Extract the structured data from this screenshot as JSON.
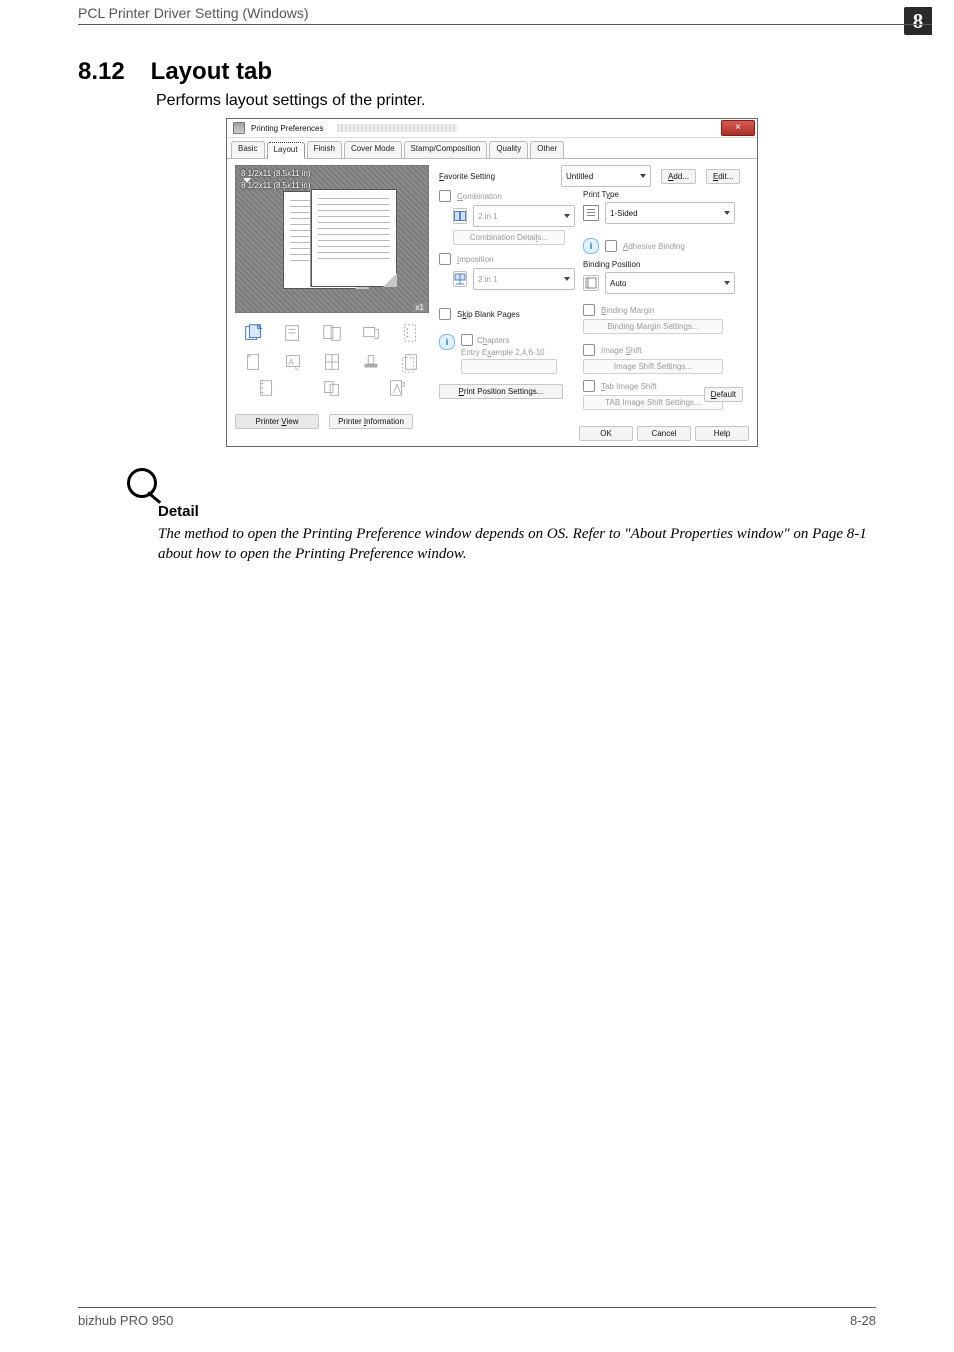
{
  "page": {
    "running_head": "PCL Printer Driver Setting (Windows)",
    "chapter_number": "8",
    "section_number": "8.12",
    "section_title": "Layout tab",
    "lead": "Performs layout settings of the printer.",
    "footer_left": "bizhub PRO 950",
    "footer_right": "8-28"
  },
  "dialog": {
    "title": "Printing Preferences",
    "tabs": {
      "basic": "Basic",
      "layout": "Layout",
      "finish": "Finish",
      "cover": "Cover Mode",
      "stamp": "Stamp/Composition",
      "quality": "Quality",
      "other": "Other"
    },
    "favorite": {
      "label": "Favorite Setting",
      "value": "Untitled",
      "add": "Add...",
      "edit": "Edit..."
    },
    "preview": {
      "dim_top": "8 1/2x11 (8.5x11 in)",
      "dim_bottom": "8 1/2x11 (8.5x11 in)",
      "multiplier": "x1"
    },
    "left_buttons": {
      "printer_view": "Printer View",
      "printer_info": "Printer Information"
    },
    "mid": {
      "combination_label": "Combination",
      "combination_value": "2 in 1",
      "combination_details": "Combination Details...",
      "imposition_label": "Imposition",
      "imposition_value": "2 in 1",
      "skip_blank": "Skip Blank Pages",
      "chapters_label": "Chapters",
      "chapters_hint": "Entry Example 2,4,6-10",
      "print_pos": "Print Position Settings..."
    },
    "right": {
      "print_type_label": "Print Type",
      "print_type_value": "1-Sided",
      "adhesive": "Adhesive Binding",
      "binding_pos_label": "Binding Position",
      "binding_pos_value": "Auto",
      "binding_margin_label": "Binding Margin",
      "binding_margin_btn": "Binding Margin Settings...",
      "image_shift_label": "Image Shift",
      "image_shift_btn": "Image Shift Settings...",
      "tab_image_shift_label": "Tab Image Shift",
      "tab_image_shift_btn": "TAB Image Shift Settings...",
      "default": "Default"
    },
    "footer": {
      "ok": "OK",
      "cancel": "Cancel",
      "help": "Help"
    },
    "icons": {
      "a": "copies",
      "b": "orientation",
      "c": "duplex",
      "d": "rotate",
      "e": "staple",
      "f": "paper",
      "g": "registration",
      "h": "grid",
      "i": "stamp",
      "j": "sort",
      "k": "scale"
    },
    "underlines": {
      "favorite": "F",
      "combination": "C",
      "imposition": "I",
      "skip": "k",
      "chapters": "h",
      "example": "x",
      "print_pos": "P",
      "add": "A",
      "edit": "E",
      "adhesive": "A",
      "print_type": "y",
      "binding_pos": "g",
      "binding_margin": "B",
      "image_shift": "S",
      "tab_shift": "T",
      "default": "D",
      "printer_view": "V",
      "printer_info": "I"
    }
  },
  "detail": {
    "heading": "Detail",
    "body": "The method to open the Printing Preference window depends on OS. Refer to \"About Properties window\" on Page 8-1 about how to open the Printing Preference window."
  }
}
